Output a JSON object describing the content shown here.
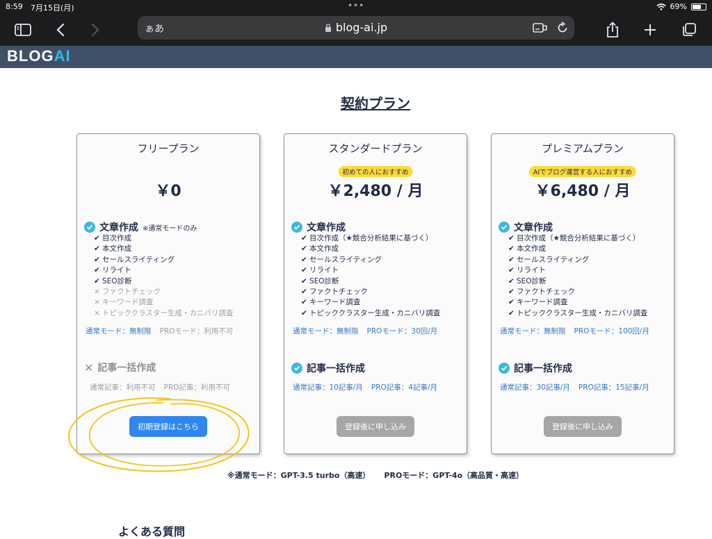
{
  "status": {
    "time": "8:59",
    "date": "7月15日(月)",
    "battery_pct": "69%",
    "battery_level": 0.69
  },
  "browser": {
    "aa_label": "ぁあ",
    "url": "blog-ai.jp"
  },
  "site": {
    "logo_part1": "BLOG",
    "logo_part2": "AI"
  },
  "page": {
    "title": "契約プラン",
    "footnote_normal": "※通常モード：GPT-3.5 turbo（高速）",
    "footnote_pro": "PROモード：GPT-4o（高品質・高速）",
    "faq_heading": "よくある質問"
  },
  "plans": [
    {
      "name": "フリープラン",
      "price": "￥0",
      "writing_title": "文章作成",
      "writing_note": "※通常モードのみ",
      "features": [
        {
          "label": "目次作成",
          "mark": "✔"
        },
        {
          "label": "本文作成",
          "mark": "✔"
        },
        {
          "label": "セールスライティング",
          "mark": "✔"
        },
        {
          "label": "リライト",
          "mark": "✔"
        },
        {
          "label": "SEO診断",
          "mark": "✔"
        },
        {
          "label": "ファクトチェック",
          "mark": "×"
        },
        {
          "label": "キーワード調査",
          "mark": "×"
        },
        {
          "label": "トピッククラスター生成・カニバリ調査",
          "mark": "×"
        }
      ],
      "mode_normal": "通常モード：無制限",
      "mode_pro": "PROモード：利用不可",
      "bulk_title": "記事一括作成",
      "bulk_normal": "通常記事：利用不可",
      "bulk_pro": "PRO記事：利用不可",
      "cta": "初期登録はこちら"
    },
    {
      "name": "スタンダードプラン",
      "badge": "初めての人におすすめ",
      "price": "￥2,480 / 月",
      "writing_title": "文章作成",
      "features": [
        {
          "label": "目次作成（★競合分析結果に基づく）",
          "mark": "✔"
        },
        {
          "label": "本文作成",
          "mark": "✔"
        },
        {
          "label": "セールスライティング",
          "mark": "✔"
        },
        {
          "label": "リライト",
          "mark": "✔"
        },
        {
          "label": "SEO診断",
          "mark": "✔"
        },
        {
          "label": "ファクトチェック",
          "mark": "✔"
        },
        {
          "label": "キーワード調査",
          "mark": "✔"
        },
        {
          "label": "トピッククラスター生成・カニバリ調査",
          "mark": "✔"
        }
      ],
      "mode_normal": "通常モード：無制限",
      "mode_pro": "PROモード：30回/月",
      "bulk_title": "記事一括作成",
      "bulk_normal": "通常記事：10記事/月",
      "bulk_pro": "PRO記事：4記事/月",
      "cta": "登録後に申し込み"
    },
    {
      "name": "プレミアムプラン",
      "badge": "AIでブログ運営する人におすすめ",
      "price": "￥6,480 / 月",
      "writing_title": "文章作成",
      "features": [
        {
          "label": "目次作成（★競合分析結果に基づく）",
          "mark": "✔"
        },
        {
          "label": "本文作成",
          "mark": "✔"
        },
        {
          "label": "セールスライティング",
          "mark": "✔"
        },
        {
          "label": "リライト",
          "mark": "✔"
        },
        {
          "label": "SEO診断",
          "mark": "✔"
        },
        {
          "label": "ファクトチェック",
          "mark": "✔"
        },
        {
          "label": "キーワード調査",
          "mark": "✔"
        },
        {
          "label": "トピッククラスター生成・カニバリ調査",
          "mark": "✔"
        }
      ],
      "mode_normal": "通常モード：無制限",
      "mode_pro": "PROモード：100回/月",
      "bulk_title": "記事一括作成",
      "bulk_normal": "通常記事：30記事/月",
      "bulk_pro": "PRO記事：15記事/月",
      "cta": "登録後に申し込み"
    }
  ],
  "colors": {
    "accent_check": "#3cb8de",
    "link_blue": "#3a78c2",
    "cta_blue": "#2f86ee",
    "cta_disabled": "#a6a6a6",
    "badge_yellow": "#ffd93b",
    "annotation_yellow": "#f2c518"
  },
  "icons": [
    "sidebar-icon",
    "back-icon",
    "forward-icon",
    "lock-icon",
    "reader-icon",
    "reload-icon",
    "share-icon",
    "new-tab-icon",
    "tabs-icon",
    "wifi-icon",
    "battery-icon",
    "check-circle-icon",
    "cross-icon"
  ]
}
